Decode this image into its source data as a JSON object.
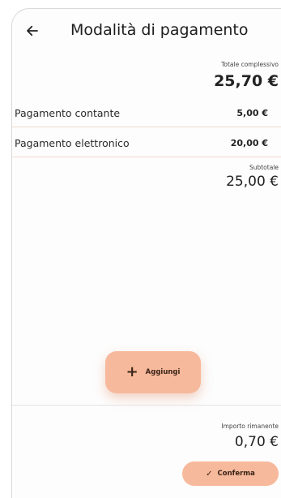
{
  "header": {
    "title": "Modalità di pagamento",
    "back_icon": "arrow-left-icon"
  },
  "summary": {
    "total_label": "Totale complessivo",
    "total_value": "25,70 €",
    "subtotal_label": "Subtotale",
    "subtotal_value": "25,00 €",
    "remaining_label": "Importo rimanente",
    "remaining_value": "0,70 €"
  },
  "payments": [
    {
      "label": "Pagamento contante",
      "amount": "5,00 €"
    },
    {
      "label": "Pagamento elettronico",
      "amount": "20,00 €"
    }
  ],
  "actions": {
    "add_label": "Aggiungi",
    "add_icon": "plus-icon",
    "confirm_label": "Conferma",
    "confirm_icon": "check-icon"
  },
  "colors": {
    "accent": "#f7b99b",
    "accent_text": "#3a2418",
    "divider": "#f0d9cf"
  }
}
